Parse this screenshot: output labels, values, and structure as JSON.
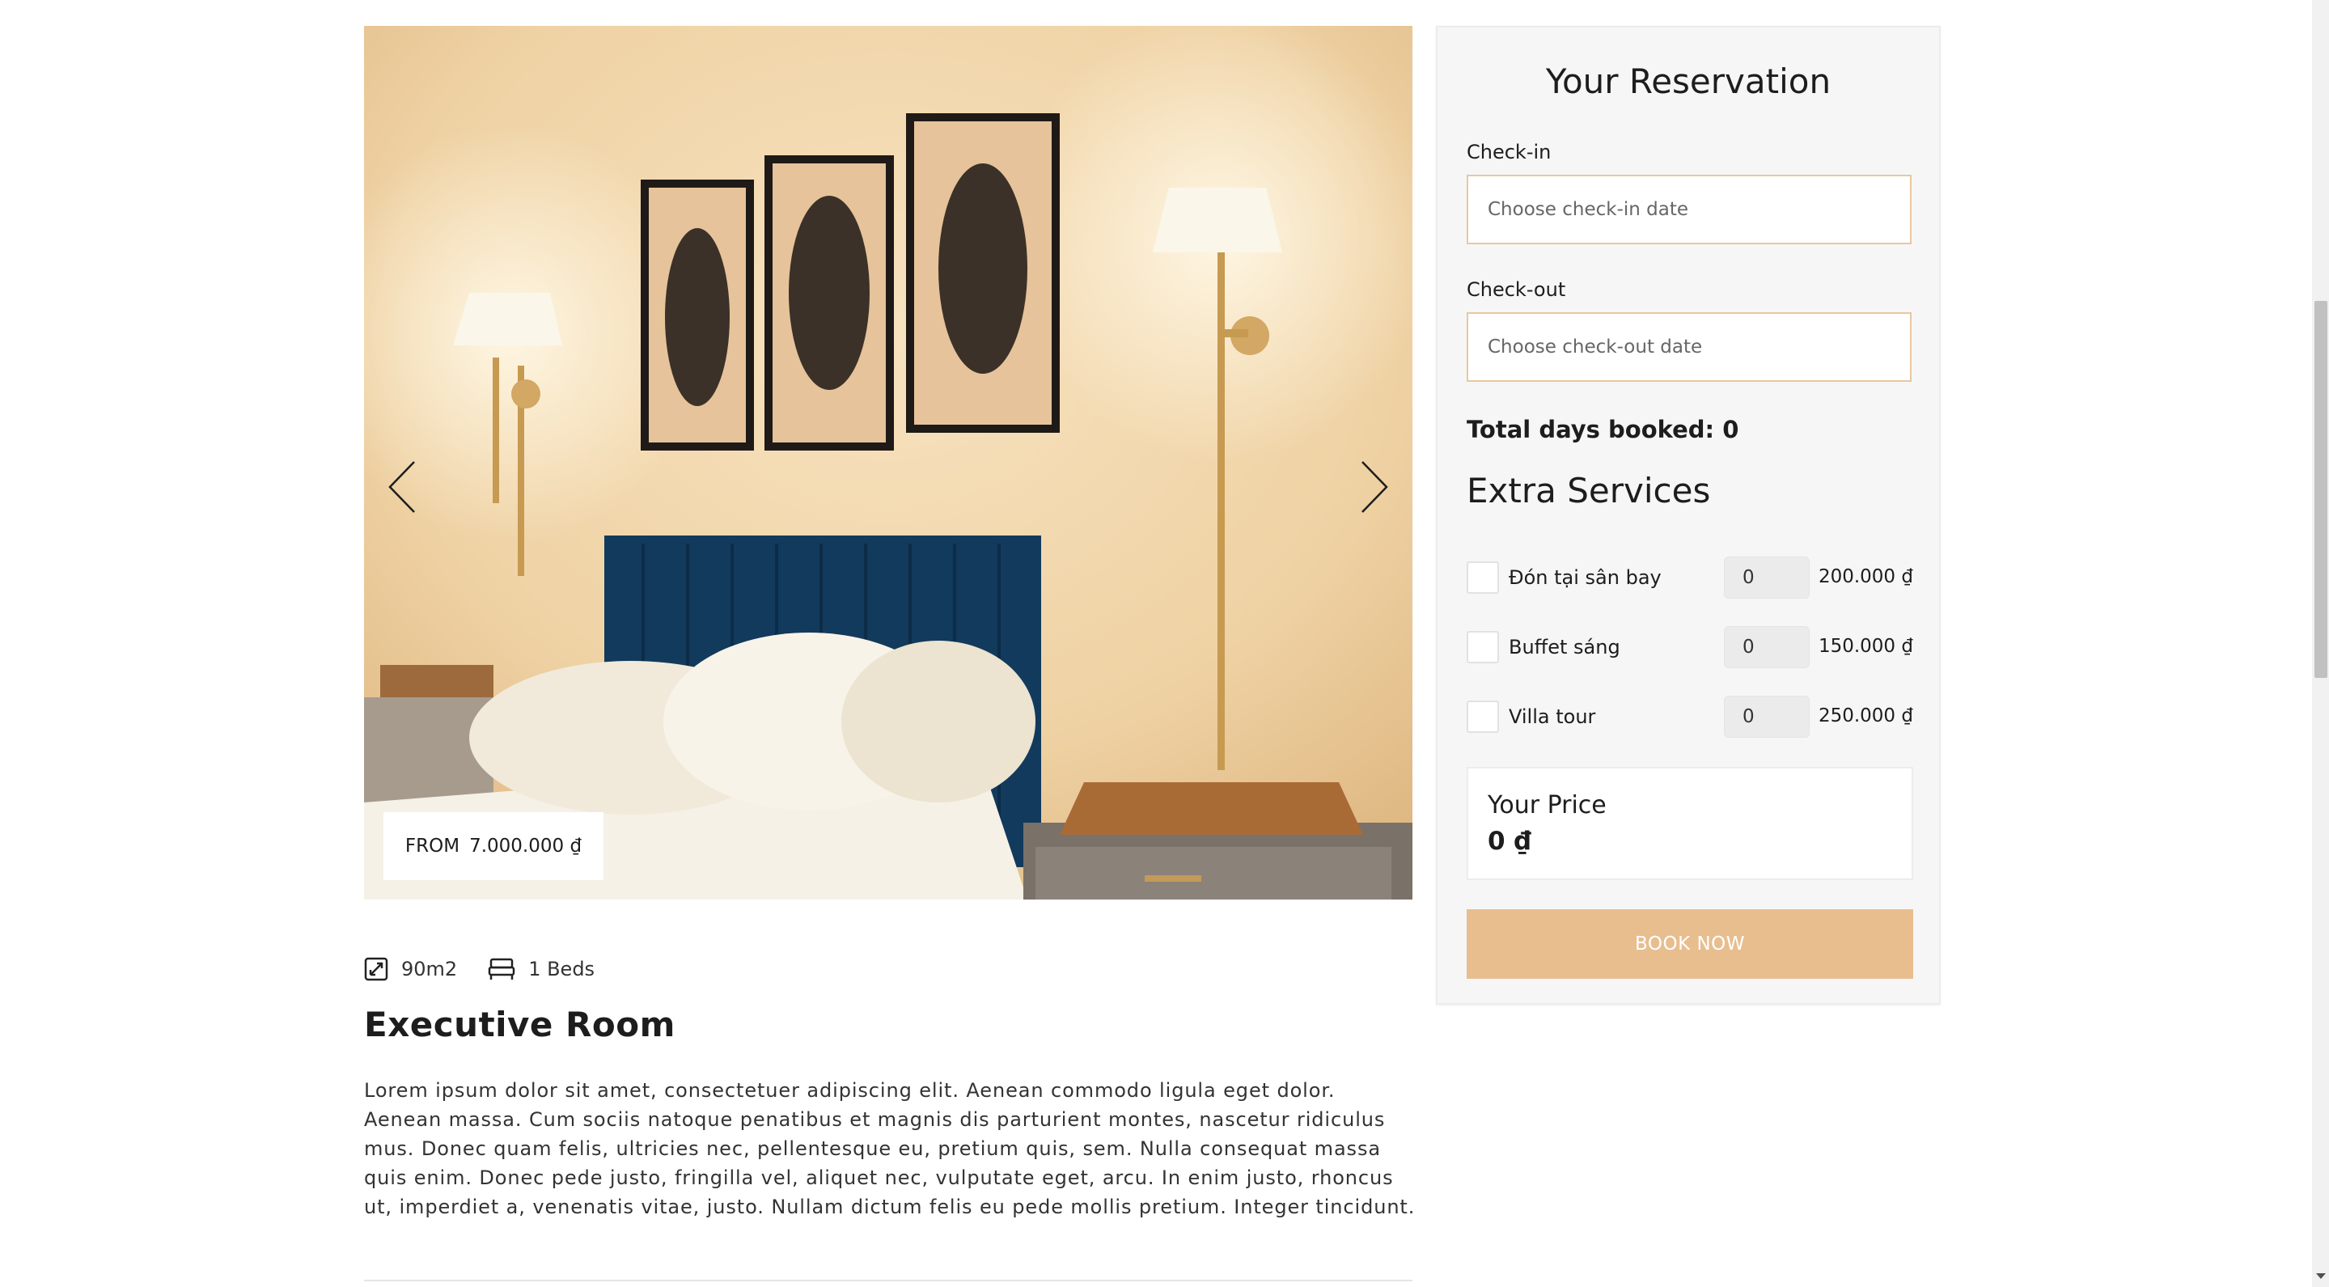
{
  "gallery": {
    "price_prefix": "FROM",
    "price_value": "7.000.000 ₫",
    "prev_icon": "chevron-left-icon",
    "next_icon": "chevron-right-icon"
  },
  "room": {
    "area": "90m2",
    "beds": "1 Beds",
    "title": "Executive Room",
    "description": "Lorem ipsum dolor sit amet, consectetuer adipiscing elit. Aenean commodo ligula eget dolor. Aenean massa. Cum sociis natoque penatibus et magnis dis parturient montes, nascetur ridiculus mus. Donec quam felis, ultricies nec, pellentesque eu, pretium quis, sem. Nulla consequat massa quis enim. Donec pede justo, fringilla vel, aliquet nec, vulputate eget, arcu. In enim justo, rhoncus ut, imperdiet a, venenatis vitae, justo. Nullam dictum felis eu pede mollis pretium. Integer tincidunt."
  },
  "reservation": {
    "title": "Your Reservation",
    "checkin_label": "Check-in",
    "checkin_placeholder": "Choose check-in date",
    "checkout_label": "Check-out",
    "checkout_placeholder": "Choose check-out date",
    "total_days": "Total days booked: 0",
    "extra_title": "Extra Services",
    "services": [
      {
        "name": "Đón tại sân bay",
        "qty": "0",
        "price": "200.000 ₫"
      },
      {
        "name": "Buffet sáng",
        "qty": "0",
        "price": "150.000 ₫"
      },
      {
        "name": "Villa tour",
        "qty": "0",
        "price": "250.000 ₫"
      }
    ],
    "your_price_label": "Your Price",
    "your_price_value": "0 ₫",
    "book_label": "BOOK NOW"
  },
  "colors": {
    "accent": "#e8be8f",
    "panel_bg": "#f6f6f6",
    "headboard": "#123a5c"
  }
}
